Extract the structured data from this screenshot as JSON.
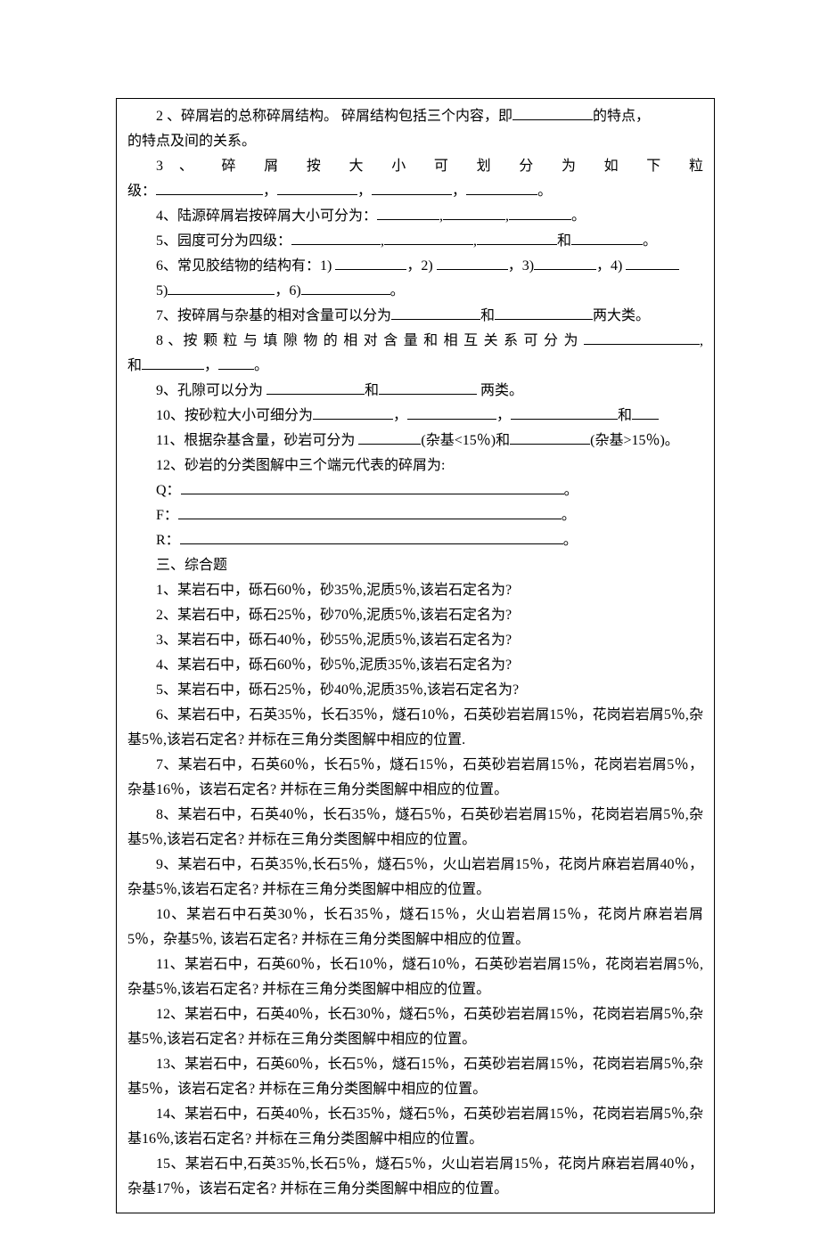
{
  "q2": {
    "prefix": "2 、碎屑岩的总称碎屑结构。 碎屑结构包括三个内容，即",
    "suffix1": "的特点，",
    "line2": "的特点及间的关系。"
  },
  "q3": {
    "line1": "3 、 碎 屑 按 大 小 可 划 分 为 如 下 粒",
    "line2_prefix": "级："
  },
  "q4": {
    "prefix": "4、陆源碎屑岩按碎屑大小可分为："
  },
  "q5": {
    "prefix": "5、园度可分为四级：",
    "and": "和"
  },
  "q6": {
    "prefix": "6、常见胶结物的结构有：1) ",
    "sep2": "，2) ",
    "sep3": "，3)",
    "sep4": "，4) ",
    "line2_prefix": "5)",
    "sep6": "，6)"
  },
  "q7": {
    "prefix": "7、按碎屑与杂基的相对含量可以分为",
    "and": "和",
    "suffix": "两大类。"
  },
  "q8": {
    "line1": "8 、按 颗 粒 与 填 隙 物 的 相 对 含 量 和 相 互 关 系 可 分 为 ",
    "line2_prefix": "和"
  },
  "q9": {
    "prefix": "9、孔隙可以分为 ",
    "and": "和",
    "suffix": " 两类。"
  },
  "q10": {
    "prefix": "10、按砂粒大小可细分为",
    "and": "和"
  },
  "q11": {
    "prefix": "11、根据杂基含量，砂岩可分为 ",
    "mid1": "(杂基<15％)和",
    "suffix": "(杂基>15％)。"
  },
  "q12": {
    "main": "12、砂岩的分类图解中三个端元代表的碎屑为:",
    "Q": "Q：",
    "F": "F：",
    "R": "R："
  },
  "section3": "三、综合题",
  "c1": "1、某岩石中，砾石60％，砂35％,泥质5％,该岩石定名为?",
  "c2": "2、某岩石中，砾石25％，砂70％,泥质5％,该岩石定名为?",
  "c3": "3、某岩石中，砾石40％，砂55％,泥质5％,该岩石定名为?",
  "c4": "4、某岩石中，砾石60％，砂5％,泥质35％,该岩石定名为?",
  "c5": "5、某岩石中，砾石25％，砂40％,泥质35％,该岩石定名为?",
  "c6": "6、某岩石中，石英35％，长石35％，燧石10％，石英砂岩岩屑15％，花岗岩岩屑5％,杂基5％,该岩石定名? 并标在三角分类图解中相应的位置.",
  "c7": "7、某岩石中，石英60％，长石5％，燧石15％，石英砂岩岩屑15％，花岗岩岩屑5％，杂基16％，该岩石定名? 并标在三角分类图解中相应的位置。",
  "c8": "8、某岩石中，石英40％，长石35％，燧石5％，石英砂岩岩屑15％，花岗岩岩屑5％,杂基5％,该岩石定名? 并标在三角分类图解中相应的位置。",
  "c9": "9、某岩石中，石英35％,长石5％，燧石5％，火山岩岩屑15％，花岗片麻岩岩屑40％，杂基5％,该岩石定名? 并标在三角分类图解中相应的位置。",
  "c10": "10、某岩石中石英30％，长石35％，燧石15％，火山岩岩屑15％，花岗片麻岩岩屑5％，杂基5％, 该岩石定名? 并标在三角分类图解中相应的位置。",
  "c11": "11、某岩石中，石英60％，长石10％，燧石10％，石英砂岩岩屑15％，花岗岩岩屑5％,杂基5％,该岩石定名? 并标在三角分类图解中相应的位置。",
  "c12": "12、某岩石中，石英40％，长石30％，燧石5％，石英砂岩岩屑15％，花岗岩岩屑5％,杂基5％,该岩石定名? 并标在三角分类图解中相应的位置。",
  "c13": "13、某岩石中，石英60％，长石5％，燧石15％，石英砂岩岩屑15％，花岗岩岩屑5％,杂基5％，该岩石定名? 并标在三角分类图解中相应的位置。",
  "c14": "14、某岩石中，石英40％，长石35％，燧石5％，石英砂岩岩屑15％，花岗岩岩屑5％,杂基16％,该岩石定名? 并标在三角分类图解中相应的位置。",
  "c15": "15、某岩石中,石英35％,长石5％，燧石5％，火山岩岩屑15％，花岗片麻岩岩屑40％，杂基17％，该岩石定名? 并标在三角分类图解中相应的位置。"
}
